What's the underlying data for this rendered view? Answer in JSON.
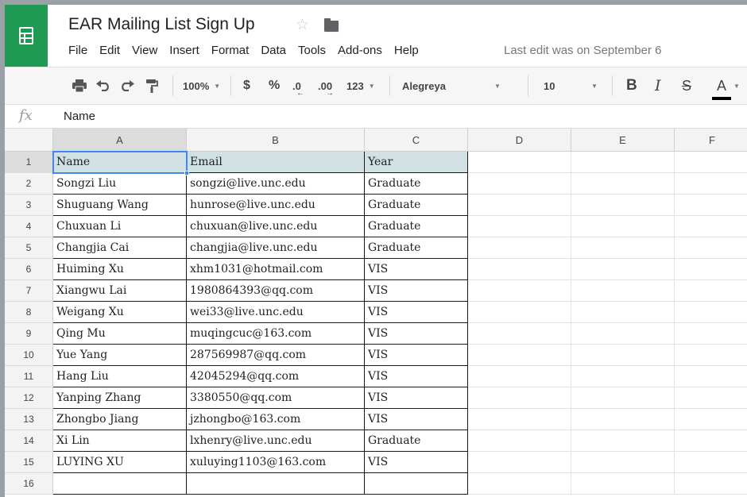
{
  "doc": {
    "title": "EAR Mailing List Sign Up",
    "last_edit": "Last edit was on September 6"
  },
  "menu": [
    "File",
    "Edit",
    "View",
    "Insert",
    "Format",
    "Data",
    "Tools",
    "Add-ons",
    "Help"
  ],
  "toolbar": {
    "zoom": "100%",
    "currency": "$",
    "percent": "%",
    "dec_decrease": ".0",
    "dec_increase": ".00",
    "more_formats": "123",
    "font": "Alegreya",
    "font_size": "10",
    "bold": "B",
    "italic": "I",
    "strike": "S",
    "text_color": "A"
  },
  "formula": {
    "label": "fx",
    "value": "Name"
  },
  "sheet": {
    "columns": [
      "A",
      "B",
      "C",
      "D",
      "E",
      "F"
    ],
    "row_numbers": [
      "1",
      "2",
      "3",
      "4",
      "5",
      "6",
      "7",
      "8",
      "9",
      "10",
      "11",
      "12",
      "13",
      "14",
      "15",
      "16"
    ],
    "header": [
      "Name",
      "Email",
      "Year"
    ],
    "rows": [
      [
        "Songzi Liu",
        "songzi@live.unc.edu",
        "Graduate"
      ],
      [
        "Shuguang Wang",
        "hunrose@live.unc.edu",
        "Graduate"
      ],
      [
        "Chuxuan Li",
        "chuxuan@live.unc.edu",
        "Graduate"
      ],
      [
        "Changjia Cai",
        "changjia@live.unc.edu",
        "Graduate"
      ],
      [
        "Huiming Xu",
        "xhm1031@hotmail.com",
        "VIS"
      ],
      [
        "Xiangwu Lai",
        "1980864393@qq.com",
        "VIS"
      ],
      [
        "Weigang Xu",
        "wei33@live.unc.edu",
        "VIS"
      ],
      [
        "Qing Mu",
        "muqingcuc@163.com",
        "VIS"
      ],
      [
        "Yue Yang",
        "287569987@qq.com",
        "VIS"
      ],
      [
        "Hang Liu",
        "42045294@qq.com",
        "VIS"
      ],
      [
        "Yanping Zhang",
        "3380550@qq.com",
        "VIS"
      ],
      [
        "Zhongbo Jiang",
        "jzhongbo@163.com",
        "VIS"
      ],
      [
        "Xi Lin",
        "lxhenry@live.unc.edu",
        "Graduate"
      ],
      [
        "LUYING XU",
        "xuluying1103@163.com",
        "VIS"
      ]
    ],
    "selected_cell": "A1"
  },
  "colors": {
    "logo": "#1e9a52",
    "header_fill": "#d0e0e3",
    "selection": "#4285f4"
  },
  "icons": [
    "sheets-logo-icon",
    "star-icon",
    "folder-icon",
    "print-icon",
    "undo-icon",
    "redo-icon",
    "paint-format-icon"
  ]
}
